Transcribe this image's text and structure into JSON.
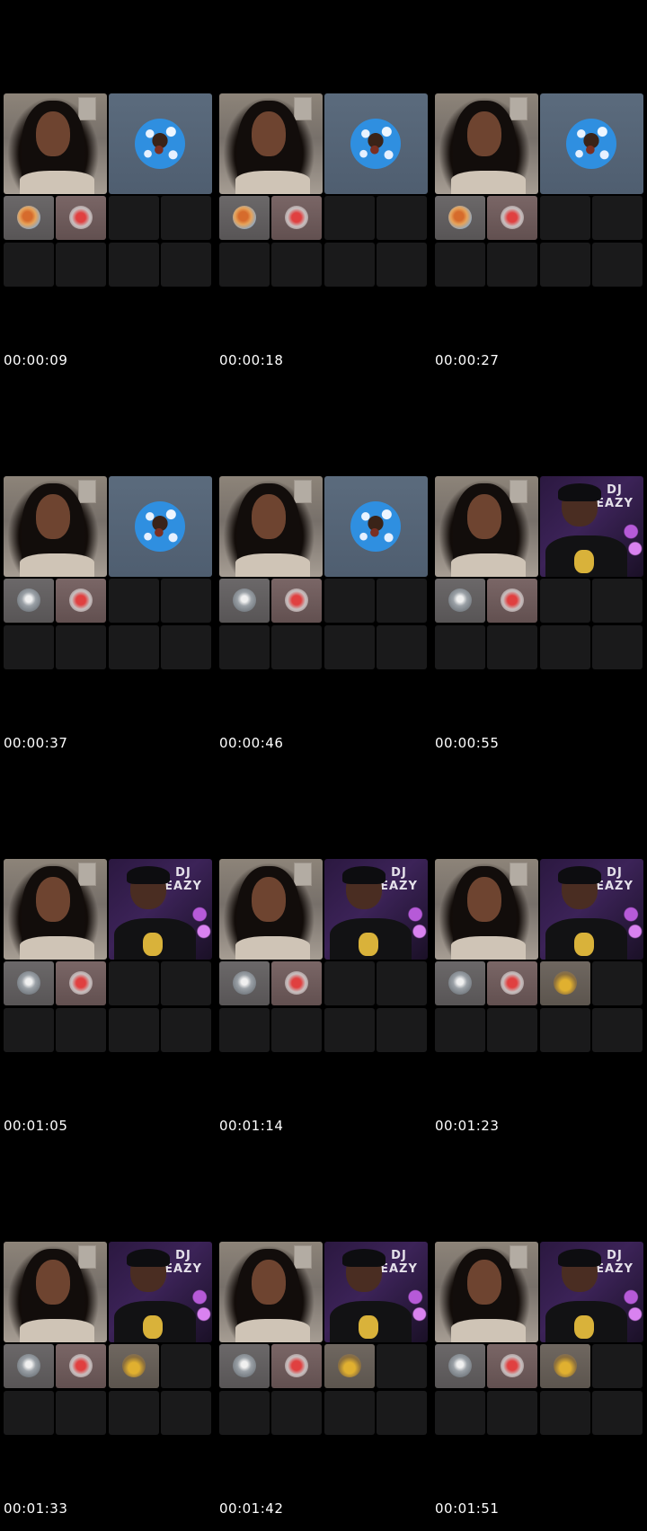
{
  "contact_sheet": {
    "frames": [
      {
        "timestamp": "00:00:09"
      },
      {
        "timestamp": "00:00:18"
      },
      {
        "timestamp": "00:00:27"
      },
      {
        "timestamp": "00:00:37"
      },
      {
        "timestamp": "00:00:46"
      },
      {
        "timestamp": "00:00:55"
      },
      {
        "timestamp": "00:01:05"
      },
      {
        "timestamp": "00:01:14"
      },
      {
        "timestamp": "00:01:23"
      },
      {
        "timestamp": "00:01:33"
      },
      {
        "timestamp": "00:01:42"
      },
      {
        "timestamp": "00:01:51"
      }
    ]
  },
  "labels": {
    "dj_logo": "DJ EAZY"
  },
  "colors": {
    "background": "#000000",
    "tile_empty": "#1a1a1b",
    "timestamp_text": "#ffffff"
  }
}
